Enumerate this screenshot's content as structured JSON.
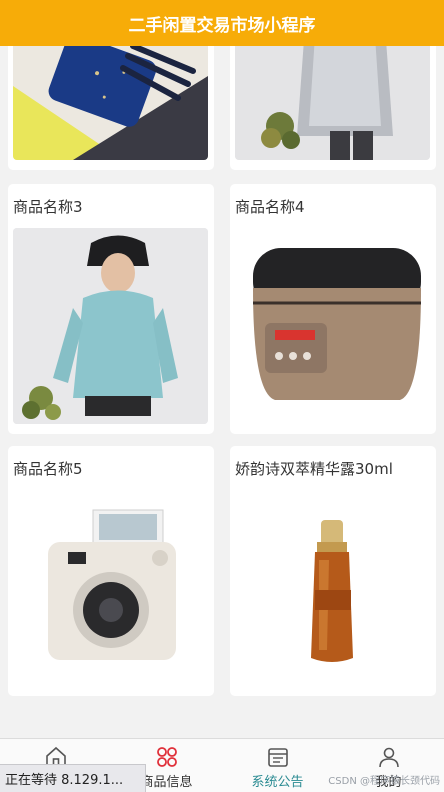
{
  "header": {
    "title": "二手闲置交易市场小程序"
  },
  "products": [
    {
      "name": "",
      "image": "makeup-brush-pouch"
    },
    {
      "name": "",
      "image": "silver-jacket-model"
    },
    {
      "name": "商品名称3",
      "image": "blue-hoodie-model"
    },
    {
      "name": "商品名称4",
      "image": "rice-cooker"
    },
    {
      "name": "商品名称5",
      "image": "instant-camera"
    },
    {
      "name": "娇韵诗双萃精华露30ml",
      "image": "serum-bottle"
    }
  ],
  "tabbar": {
    "items": [
      {
        "label": "首页",
        "icon": "home-icon"
      },
      {
        "label": "商品信息",
        "icon": "grid-icon",
        "color": "#e0303a"
      },
      {
        "label": "系统公告",
        "icon": "notice-icon",
        "active": true,
        "color": "#2a8b92"
      },
      {
        "label": "我的",
        "icon": "user-icon"
      }
    ]
  },
  "status": {
    "loading_text": "正在等待 8.129.1..."
  },
  "watermark": {
    "text": "CSDN @程序猿长颈代码"
  },
  "colors": {
    "header": "#f7ac08",
    "active_tab": "#2a8b92",
    "accent": "#e0303a"
  }
}
